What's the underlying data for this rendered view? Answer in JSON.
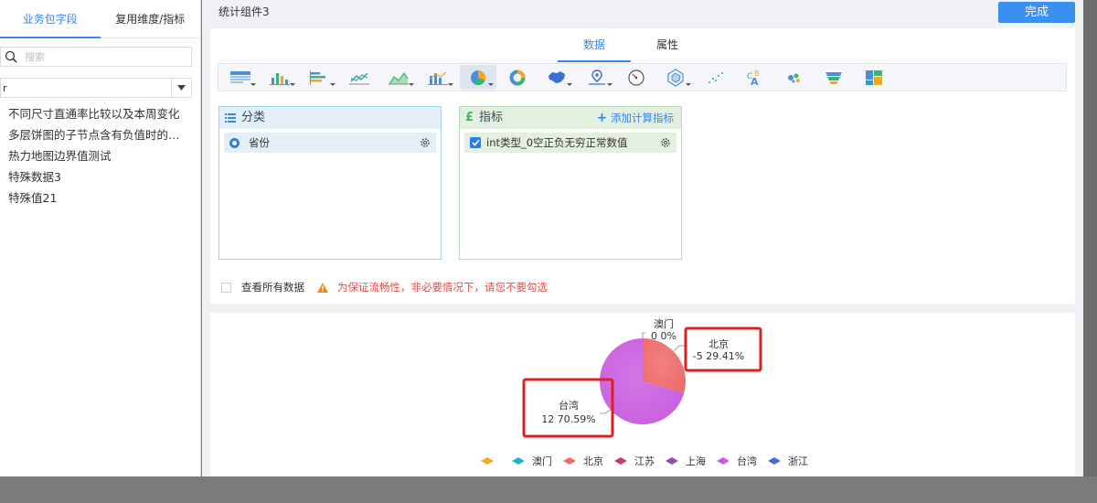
{
  "left": {
    "tabs": [
      {
        "label": "业务包字段",
        "active": true
      },
      {
        "label": "复用维度/指标",
        "active": false
      }
    ],
    "search_placeholder": "搜索",
    "select_value": "r",
    "items": [
      "不同尺寸直通率比较以及本周变化",
      "多层饼图的子节点含有负值时的…",
      "热力地图边界值测试",
      "特殊数据3",
      "特殊值21"
    ]
  },
  "main": {
    "component_title": "统计组件3",
    "done_label": "完成",
    "subtabs": [
      {
        "label": "数据",
        "active": true
      },
      {
        "label": "属性",
        "active": false
      }
    ],
    "chart_types": [
      "table-icon",
      "bar-chart-icon",
      "stacked-bar-icon",
      "line-chart-icon",
      "area-chart-icon",
      "combo-chart-icon",
      "pie-chart-icon",
      "donut-chart-icon",
      "map-icon",
      "point-map-icon",
      "gauge-icon",
      "radar-icon",
      "scatter-icon",
      "word-cloud-icon",
      "bubble-icon",
      "funnel-icon",
      "treemap-icon"
    ],
    "category": {
      "title": "分类",
      "field": "省份"
    },
    "indicator": {
      "title": "指标",
      "add_label": "添加计算指标",
      "field": "int类型_0空正负无穷正常数值"
    },
    "view_all_label": "查看所有数据",
    "warning_text": "为保证流畅性，非必要情况下，请您不要勾选"
  },
  "chart_data": {
    "type": "pie",
    "labels": [
      {
        "name": "澳门",
        "value": "0",
        "percent": "0%"
      },
      {
        "name": "北京",
        "value": "-5",
        "percent": "29.41%"
      },
      {
        "name": "台湾",
        "value": "12",
        "percent": "70.59%"
      }
    ],
    "slices": [
      {
        "name": "北京",
        "value": 29.41,
        "color": "#ef6b6b"
      },
      {
        "name": "台湾",
        "value": 70.59,
        "color": "#c95fe0"
      }
    ],
    "legend": [
      {
        "name": "",
        "color": "#f5a623",
        "shape": "diamond"
      },
      {
        "name": "澳门",
        "color": "#1cb5c7",
        "shape": "diamond"
      },
      {
        "name": "北京",
        "color": "#ef6b6b",
        "shape": "diamond"
      },
      {
        "name": "江苏",
        "color": "#c43f6d",
        "shape": "diamond"
      },
      {
        "name": "上海",
        "color": "#8e4bb0",
        "shape": "diamond"
      },
      {
        "name": "台湾",
        "color": "#c95fe0",
        "shape": "diamond"
      },
      {
        "name": "浙江",
        "color": "#4a6ad9",
        "shape": "diamond"
      }
    ]
  },
  "colors": {
    "accent": "#3685f2",
    "highlight_box": "#e02020",
    "warning": "#e64b4b"
  }
}
